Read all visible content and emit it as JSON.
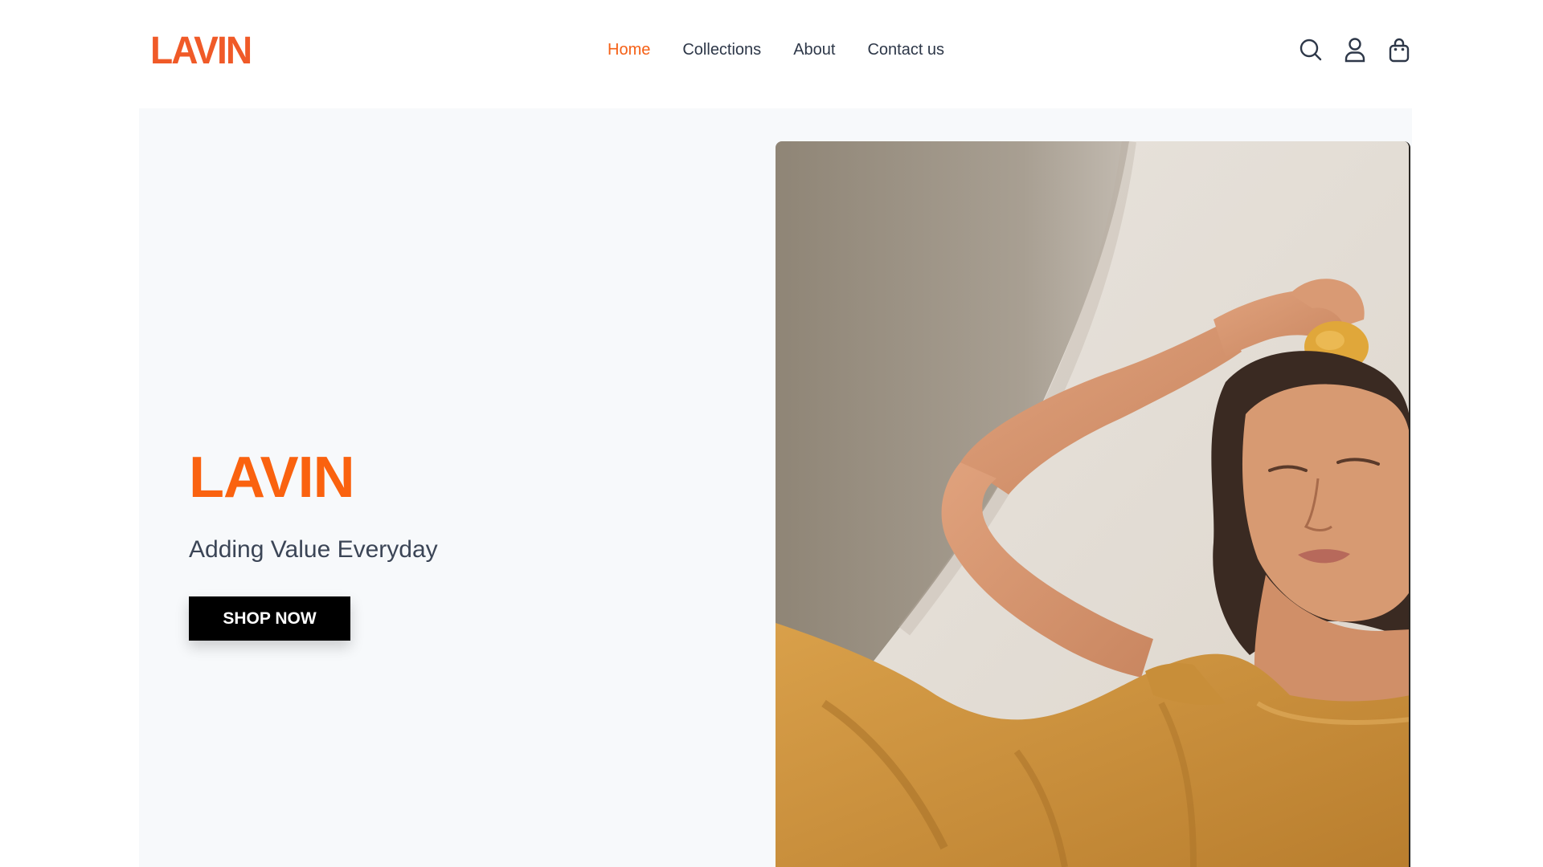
{
  "brand": {
    "logo_text": "LAVIN",
    "accent_color": "#f56016"
  },
  "nav": {
    "items": [
      {
        "label": "Home",
        "active": true
      },
      {
        "label": "Collections",
        "active": false
      },
      {
        "label": "About",
        "active": false
      },
      {
        "label": "Contact us",
        "active": false
      }
    ]
  },
  "header_icons": [
    "search-icon",
    "user-icon",
    "shopping-bag-icon"
  ],
  "hero": {
    "title": "LAVIN",
    "subtitle": "Adding Value Everyday",
    "cta_label": "SHOP NOW",
    "image_subject": "woman in mustard linen outfit holding a lemon on her head"
  }
}
